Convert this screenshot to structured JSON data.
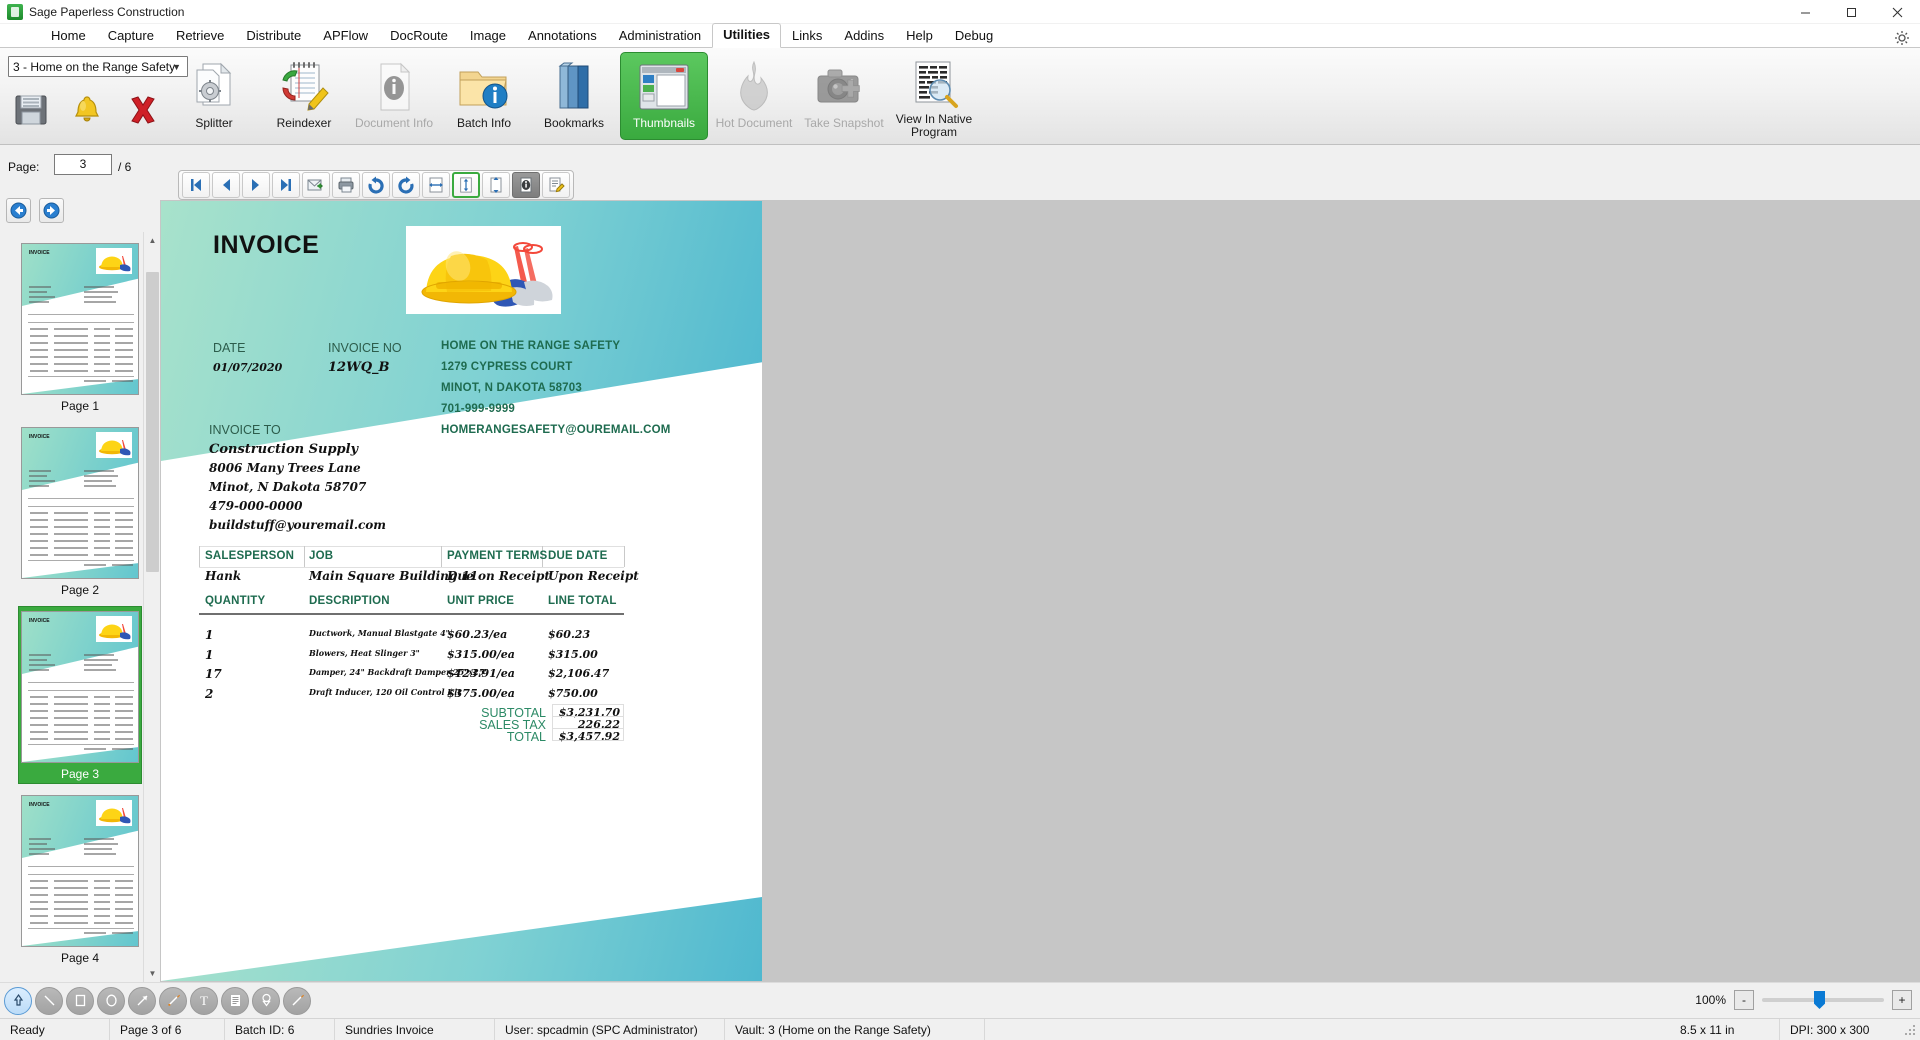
{
  "window": {
    "title": "Sage Paperless Construction",
    "icon": "app-icon",
    "minimize": "minimize",
    "maximize": "maximize",
    "close": "close"
  },
  "menu": {
    "items": [
      {
        "label": "Home",
        "active": false
      },
      {
        "label": "Capture",
        "active": false
      },
      {
        "label": "Retrieve",
        "active": false
      },
      {
        "label": "Distribute",
        "active": false
      },
      {
        "label": "APFlow",
        "active": false
      },
      {
        "label": "DocRoute",
        "active": false
      },
      {
        "label": "Image",
        "active": false
      },
      {
        "label": "Annotations",
        "active": false
      },
      {
        "label": "Administration",
        "active": false
      },
      {
        "label": "Utilities",
        "active": true
      },
      {
        "label": "Links",
        "active": false
      },
      {
        "label": "Addins",
        "active": false
      },
      {
        "label": "Help",
        "active": false
      },
      {
        "label": "Debug",
        "active": false
      }
    ]
  },
  "ribbon": {
    "vault_value": "3 - Home on the Range Safety",
    "quick": [
      {
        "name": "save-button",
        "tip": "Save"
      },
      {
        "name": "notify-button",
        "tip": "Notify"
      },
      {
        "name": "delete-button",
        "tip": "Delete"
      }
    ],
    "buttons": [
      {
        "label": "Splitter",
        "state": "enabled"
      },
      {
        "label": "Reindexer",
        "state": "enabled"
      },
      {
        "label": "Document Info",
        "state": "disabled"
      },
      {
        "label": "Batch Info",
        "state": "enabled"
      },
      {
        "label": "Bookmarks",
        "state": "enabled"
      },
      {
        "label": "Thumbnails",
        "state": "selected"
      },
      {
        "label": "Hot Document",
        "state": "disabled"
      },
      {
        "label": "Take Snapshot",
        "state": "disabled"
      },
      {
        "label": "View In Native Program",
        "state": "enabled"
      }
    ]
  },
  "pagebar": {
    "page_label": "Page:",
    "page_value": "3",
    "page_total": "/ 6",
    "nav": [
      "first-page",
      "previous-page",
      "next-page",
      "last-page",
      "email",
      "print",
      "rotate-left",
      "rotate-right",
      "fit-width",
      "fit-page",
      "fit-height",
      "page-info",
      "annotate"
    ],
    "history": [
      "back",
      "forward"
    ]
  },
  "thumbnails": {
    "pages": [
      {
        "caption": "Page 1",
        "selected": false
      },
      {
        "caption": "Page 2",
        "selected": false
      },
      {
        "caption": "Page 3",
        "selected": true
      },
      {
        "caption": "Page 4",
        "selected": false
      }
    ]
  },
  "document": {
    "title": "INVOICE",
    "date_label": "DATE",
    "date_value": "01/07/2020",
    "invoice_no_label": "INVOICE NO",
    "invoice_no_value": "12WQ_B",
    "company": [
      "HOME ON THE RANGE SAFETY",
      "1279 CYPRESS COURT",
      "MINOT, N DAKOTA 58703",
      "701-999-9999",
      "HOMERANGESAFETY@OUREMAIL.COM"
    ],
    "invoice_to_label": "INVOICE TO",
    "bill_to": [
      "Construction Supply",
      "8006 Many Trees Lane",
      "Minot, N Dakota 58707",
      "479-000-0000",
      "buildstuff@youremail.com"
    ],
    "meta_headers": [
      "SALESPERSON",
      "JOB",
      "PAYMENT TERMS",
      "DUE DATE"
    ],
    "meta_values": [
      "Hank",
      "Main Square Building 11",
      "Due on Receipt",
      "Upon Receipt"
    ],
    "line_headers": [
      "QUANTITY",
      "DESCRIPTION",
      "UNIT PRICE",
      "LINE TOTAL"
    ],
    "line_items": [
      {
        "qty": "1",
        "desc": "Ductwork, Manual Blastgate 4\"",
        "unit": "$60.23/ea",
        "total": "$60.23"
      },
      {
        "qty": "1",
        "desc": "Blowers, Heat Slinger 3\"",
        "unit": "$315.00/ea",
        "total": "$315.00"
      },
      {
        "qty": "17",
        "desc": "Damper, 24\" Backdraft Damper 25\"x25\"",
        "unit": "$123.91/ea",
        "total": "$2,106.47"
      },
      {
        "qty": "2",
        "desc": "Draft Inducer, 120 Oil Control Kit",
        "unit": "$375.00/ea",
        "total": "$750.00"
      }
    ],
    "totals": [
      {
        "label": "SUBTOTAL",
        "value": "$3,231.70"
      },
      {
        "label": "SALES TAX",
        "value": "226.22"
      },
      {
        "label": "TOTAL",
        "value": "$3,457.92"
      }
    ]
  },
  "tools": [
    "pointer-tool",
    "line-tool",
    "rectangle-tool",
    "ellipse-tool",
    "arrow-tool",
    "highlighter-tool",
    "text-tool",
    "note-tool",
    "stamp-tool",
    "pen-tool"
  ],
  "zoom": {
    "percent": "100%",
    "minus": "-",
    "plus": "+"
  },
  "statusbar": {
    "ready": "Ready",
    "page": "Page 3 of 6",
    "batch": "Batch ID: 6",
    "doctype": "Sundries Invoice",
    "user": "User: spcadmin (SPC Administrator)",
    "vault": "Vault: 3 (Home on the Range Safety)",
    "size": "8.5 x 11 in",
    "dpi": "DPI: 300 x 300"
  },
  "colors": {
    "accent_green": "#3aaa3f",
    "invoice_green": "#1e6b4f",
    "band_start": "#a8e2cb",
    "band_end": "#4fb8cf",
    "selection_blue": "#0a7ad4"
  }
}
